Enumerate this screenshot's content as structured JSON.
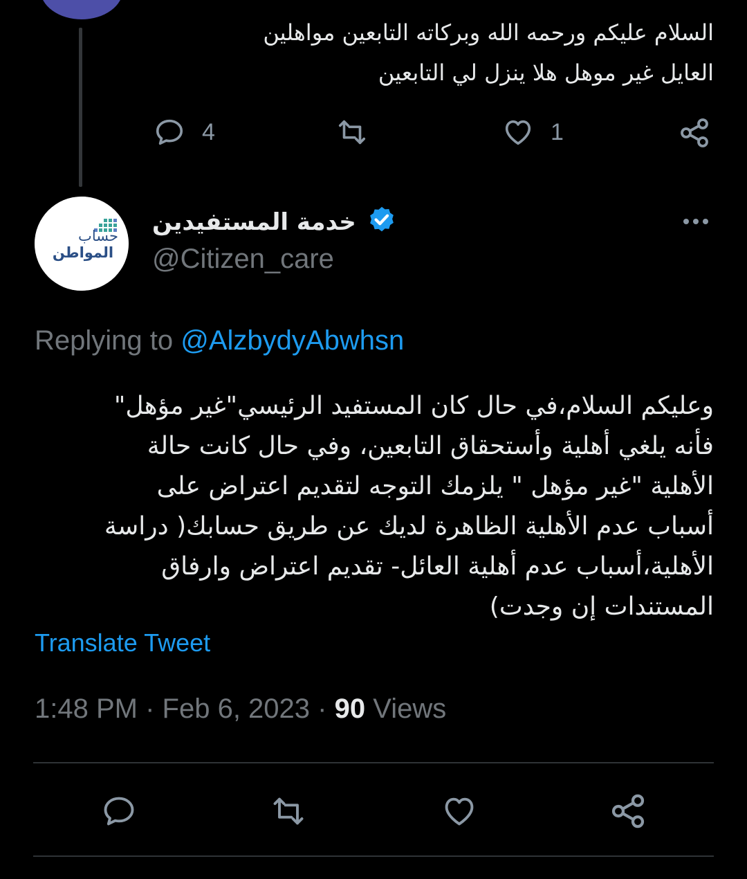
{
  "previous_tweet": {
    "text_lines": [
      "السلام عليكم ورحمه الله وبركاته التابعين مواهلين",
      "العايل غير موهل هلا ينزل لي التابعين"
    ],
    "replies_count": "4",
    "likes_count": "1"
  },
  "tweet": {
    "author_name": "خدمة المستفيدين",
    "handle": "@Citizen_care",
    "avatar_logo_lines": [
      "حساب",
      "المواطن"
    ],
    "replying_prefix": "Replying to",
    "replying_to": "@AlzbydyAbwhsn",
    "body_lines": [
      "وعليكم السلام،في حال كان المستفيد الرئيسي\"غير مؤهل\"",
      "فأنه يلغي أهلية وأستحقاق التابعين، وفي حال كانت حالة",
      "الأهلية \"غير مؤهل \" يلزمك التوجه لتقديم اعتراض على",
      "أسباب عدم الأهلية الظاهرة لديك عن طريق حسابك( دراسة",
      "الأهلية،أسباب عدم أهلية العائل- تقديم اعتراض وارفاق",
      "المستندات إن وجدت)"
    ],
    "translate_label": "Translate Tweet",
    "time": "1:48 PM",
    "separator": "·",
    "date": "Feb 6, 2023",
    "views_count": "90",
    "views_label": "Views"
  },
  "icons": {
    "reply": "reply-icon",
    "retweet": "retweet-icon",
    "like": "heart-icon",
    "share": "share-icon",
    "verified": "verified-badge-icon",
    "more": "more-icon"
  },
  "colors": {
    "background": "#000000",
    "text": "#e7e9ea",
    "secondary": "#71767b",
    "accent": "#1d9bf0",
    "verified": "#1d9bf0"
  }
}
